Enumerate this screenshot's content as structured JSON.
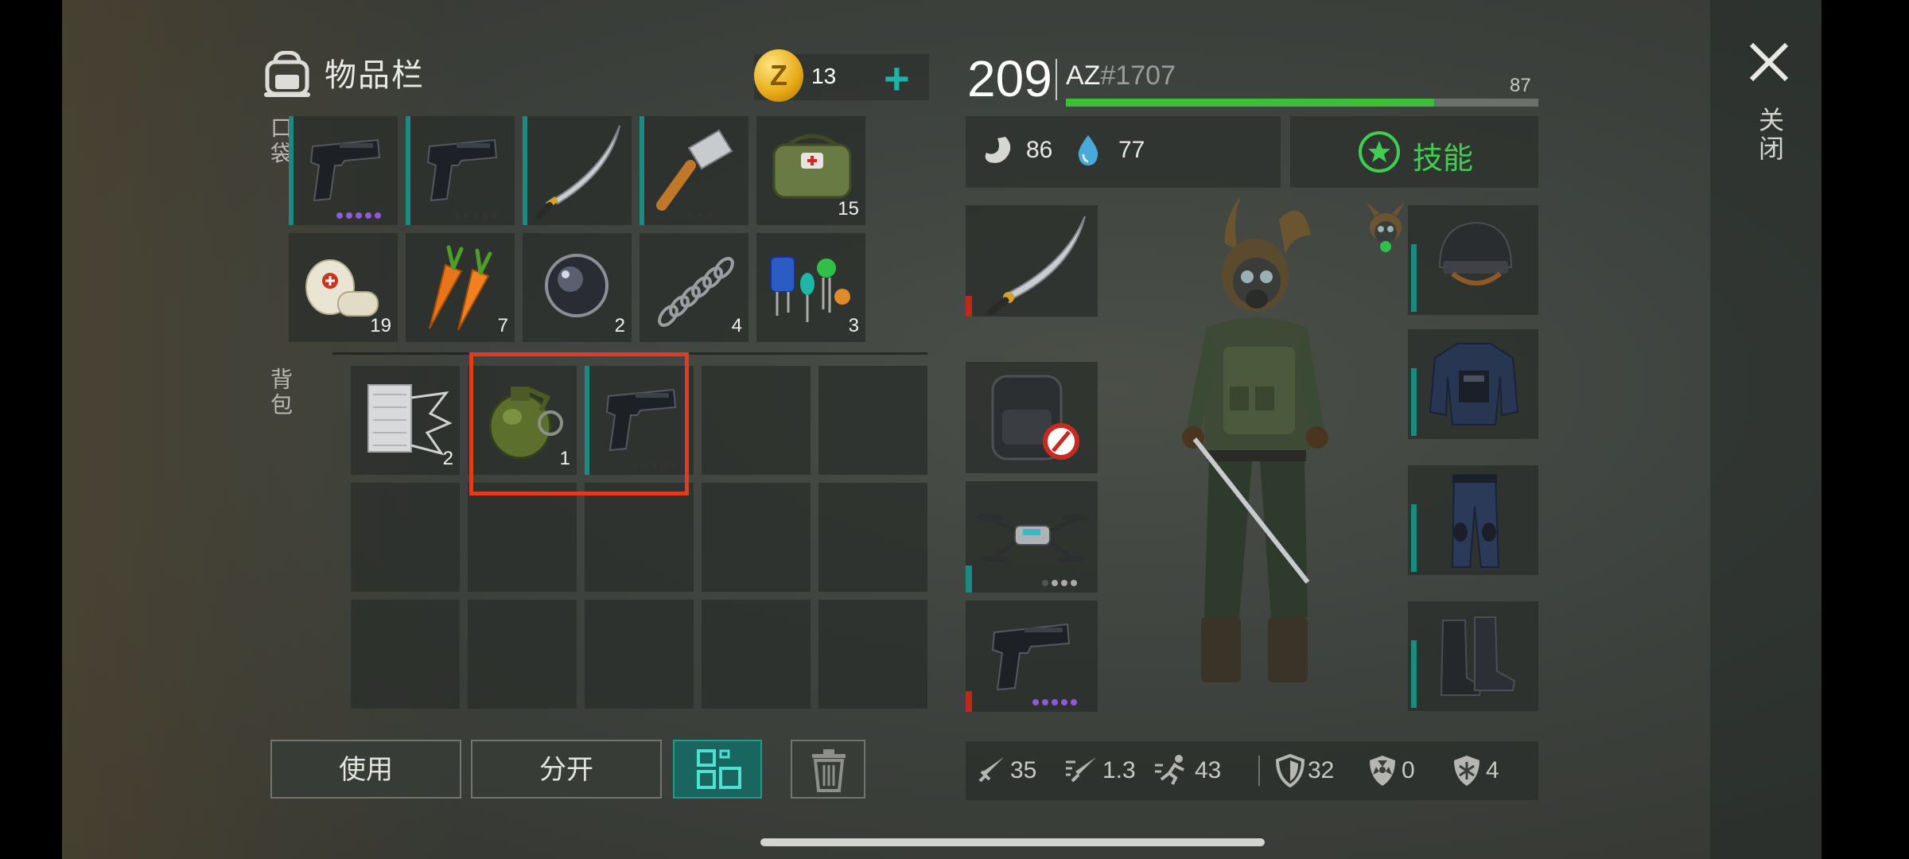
{
  "header": {
    "title": "物品栏",
    "coins": "13",
    "plus": "+"
  },
  "sections": {
    "pocket": "口袋",
    "backpack": "背包"
  },
  "pocket_items": [
    {
      "icon": "pistol-icon",
      "count": ""
    },
    {
      "icon": "pistol-icon",
      "count": ""
    },
    {
      "icon": "katana-icon",
      "count": ""
    },
    {
      "icon": "cleaver-icon",
      "count": ""
    },
    {
      "icon": "medkit-bag-icon",
      "count": "15"
    },
    {
      "icon": "bandage-icon",
      "count": "19"
    },
    {
      "icon": "carrot-icon",
      "count": "7"
    },
    {
      "icon": "lens-icon",
      "count": "2"
    },
    {
      "icon": "spring-icon",
      "count": "4"
    },
    {
      "icon": "electronic-parts-icon",
      "count": "3"
    }
  ],
  "backpack_items": [
    {
      "icon": "fabric-roll-icon",
      "count": "2"
    },
    {
      "icon": "grenade-icon",
      "count": "1"
    },
    {
      "icon": "pistol-icon",
      "count": ""
    }
  ],
  "buttons": {
    "use": "使用",
    "split": "分开"
  },
  "player": {
    "level": "209",
    "name": "AZ",
    "tag": "#1707",
    "xp": "87",
    "xp_fraction": 0.78
  },
  "vitals": {
    "hunger": "86",
    "thirst": "77"
  },
  "skills_label": "技能",
  "equipment": [
    "katana-icon",
    "backpack-icon",
    "drone-icon",
    "pistol-icon"
  ],
  "armor": [
    "helmet-icon",
    "vest-icon",
    "pants-icon",
    "boots-icon"
  ],
  "stats": {
    "melee": "35",
    "attack_speed": "1.3",
    "speed": "43",
    "armor": "32",
    "radiation": "0",
    "cold": "4"
  },
  "close_label": "关闭",
  "colors": {
    "accent_teal": "#1a8a82",
    "xp_green": "#3cbf36",
    "highlight_red": "#e23b1e",
    "skill_green": "#3ecf52"
  }
}
